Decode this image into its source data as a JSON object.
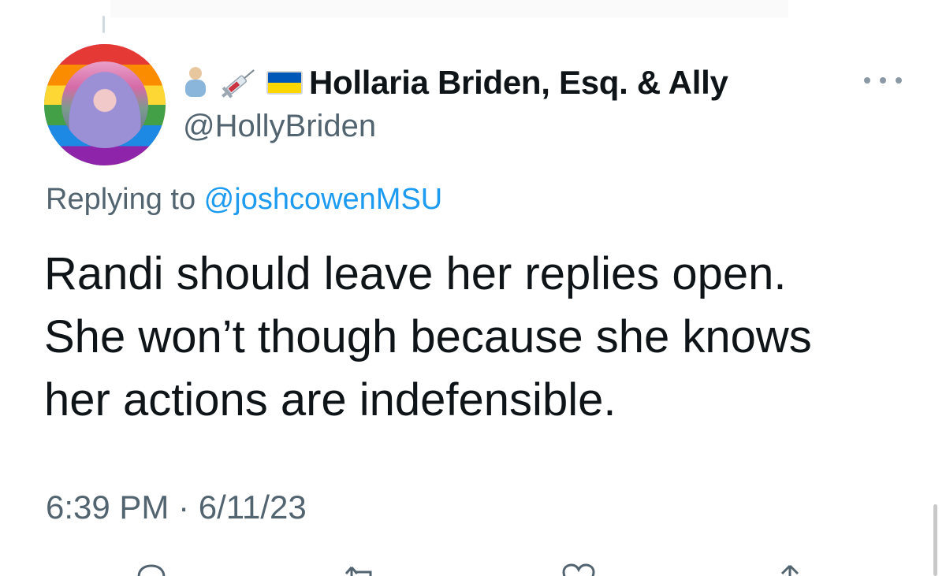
{
  "tweet": {
    "author": {
      "display_name": "Hollaria Briden, Esq. & Ally",
      "handle": "@HollyBriden",
      "name_emojis": [
        "pregnant-man-icon",
        "syringe-icon",
        "ukraine-flag-icon"
      ]
    },
    "replying_prefix": "Replying to ",
    "replying_to": "@joshcowenMSU",
    "text": "Randi should leave her replies open.\nShe won’t though because she knows\nher actions are indefensible.",
    "time": "6:39 PM",
    "separator": " · ",
    "date": "6/11/23"
  },
  "colors": {
    "text_primary": "#0f1419",
    "text_secondary": "#536471",
    "link": "#1d9bf0"
  },
  "actions": [
    "reply-icon",
    "retweet-icon",
    "like-icon",
    "share-icon"
  ]
}
